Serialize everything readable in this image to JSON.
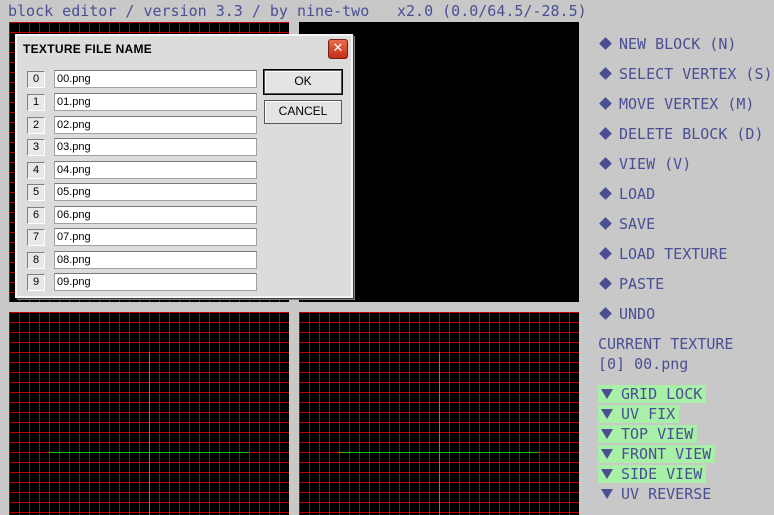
{
  "status_bar": {
    "title": "block editor / version 3.3 / by nine-two",
    "zoom": "x2.0 (0.0/64.5/-28.5)"
  },
  "colors": {
    "accent": "#4a4f93",
    "grid": "#c00000",
    "axis": "#16c016",
    "toggle_on": "#a8f0a8"
  },
  "menu": [
    {
      "label": "NEW BLOCK (N)",
      "icon": "diamond-icon"
    },
    {
      "label": "SELECT VERTEX (S)",
      "icon": "diamond-icon"
    },
    {
      "label": "MOVE VERTEX (M)",
      "icon": "diamond-icon"
    },
    {
      "label": "DELETE BLOCK (D)",
      "icon": "diamond-icon"
    },
    {
      "label": "VIEW (V)",
      "icon": "diamond-icon"
    },
    {
      "label": "LOAD",
      "icon": "diamond-icon"
    },
    {
      "label": "SAVE",
      "icon": "diamond-icon"
    },
    {
      "label": "LOAD TEXTURE",
      "icon": "diamond-icon"
    },
    {
      "label": "PASTE",
      "icon": "diamond-icon"
    },
    {
      "label": "UNDO",
      "icon": "diamond-icon"
    }
  ],
  "current_texture": {
    "label": "CURRENT TEXTURE",
    "value": "[0] 00.png"
  },
  "toggles": [
    {
      "label": "GRID LOCK",
      "on": true
    },
    {
      "label": "UV FIX",
      "on": true
    },
    {
      "label": "TOP VIEW",
      "on": true
    },
    {
      "label": "FRONT VIEW",
      "on": true
    },
    {
      "label": "SIDE VIEW",
      "on": true
    },
    {
      "label": "UV REVERSE",
      "on": false
    }
  ],
  "dialog": {
    "title": "TEXTURE FILE NAME",
    "close_glyph": "✕",
    "ok_label": "OK",
    "cancel_label": "CANCEL",
    "rows": [
      {
        "index": "0",
        "value": "00.png"
      },
      {
        "index": "1",
        "value": "01.png"
      },
      {
        "index": "2",
        "value": "02.png"
      },
      {
        "index": "3",
        "value": "03.png"
      },
      {
        "index": "4",
        "value": "04.png"
      },
      {
        "index": "5",
        "value": "05.png"
      },
      {
        "index": "6",
        "value": "06.png"
      },
      {
        "index": "7",
        "value": "07.png"
      },
      {
        "index": "8",
        "value": "08.png"
      },
      {
        "index": "9",
        "value": "09.png"
      }
    ]
  }
}
